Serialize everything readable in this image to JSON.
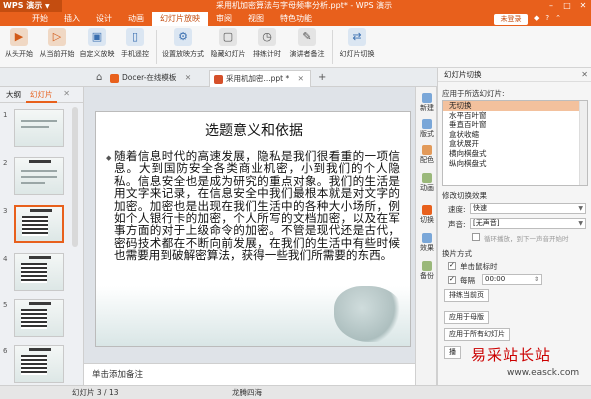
{
  "app": {
    "logo": "WPS 演示",
    "title": "采用机加密算法与字母频率分析.ppt* - WPS 演示",
    "win_min": "–",
    "win_max": "□",
    "win_close": "✕"
  },
  "menu": {
    "items": [
      "开始",
      "插入",
      "设计",
      "动画",
      "幻灯片放映",
      "审阅",
      "视图",
      "特色功能"
    ],
    "active": "幻灯片放映",
    "login": "未登录"
  },
  "ribbon": {
    "buttons": [
      {
        "label": "从头开始",
        "icon": "play-start-icon"
      },
      {
        "label": "从当前开始",
        "icon": "play-current-icon"
      },
      {
        "label": "自定义放映",
        "icon": "custom-show-icon"
      },
      {
        "label": "手机遥控",
        "icon": "phone-remote-icon"
      },
      {
        "label": "设置放映方式",
        "icon": "show-settings-icon"
      },
      {
        "label": "隐藏幻灯片",
        "icon": "hide-slide-icon"
      },
      {
        "label": "排练计时",
        "icon": "rehearse-timing-icon"
      },
      {
        "label": "演讲者备注",
        "icon": "speaker-notes-icon"
      },
      {
        "label": "幻灯片切换",
        "icon": "slide-transition-icon"
      }
    ]
  },
  "tabs": [
    {
      "label": "Docer-在线模板",
      "active": false
    },
    {
      "label": "采用机加密...ppt *",
      "active": true
    }
  ],
  "left_panel": {
    "tabs": [
      "大纲",
      "幻灯片"
    ],
    "active_tab": "幻灯片",
    "thumb_numbers": [
      "1",
      "2",
      "3",
      "4",
      "5",
      "6"
    ],
    "selected": "3"
  },
  "slide": {
    "title": "选题意义和依据",
    "body": "随着信息时代的高速发展，隐私是我们很看重的一项信息。大到国防安全各类商业机密，小到我们的个人隐私。信息安全也是成为研究的重点对象。我们的生活是用文字来记录，在信息安全中我们最根本就是对文字的加密。加密也是出现在我们生活中的各种大小场所，例如个人银行卡的加密，个人所写的文档加密，以及在军事方面的对于上级命令的加密。不管是现代还是古代，密码技术都在不断向前发展，在我们的生活中有些时候也需要用到破解密算法，获得一些我们所需要的东西。",
    "notes_placeholder": "单击添加备注"
  },
  "icon_bar": [
    "新建",
    "版式",
    "配色",
    "动画",
    "切换",
    "效果",
    "备份"
  ],
  "right_panel": {
    "header": "幻灯片切换",
    "apply_label": "应用于所选幻灯片:",
    "transitions": [
      "无切换",
      "水平百叶窗",
      "垂直百叶窗",
      "盒状收缩",
      "盒状展开",
      "横向棋盘式",
      "纵向棋盘式"
    ],
    "selected_transition": "无切换",
    "modify_label": "修改切换效果",
    "speed_label": "速度:",
    "speed_value": "快速",
    "sound_label": "声音:",
    "sound_value": "[无声音]",
    "loop_label": "循环播放，到下一声音开始时",
    "advance_label": "换片方式",
    "click_label": "单击鼠标时",
    "every_label": "每隔",
    "every_value": "00:00",
    "rehearse_btn": "排练当前页",
    "apply_master_btn": "应用于母版",
    "apply_all_btn": "应用于所有幻灯片",
    "play_btn": "播"
  },
  "status": {
    "slide_info": "幻灯片 3 / 13",
    "theme": "龙腾四海"
  },
  "watermark": {
    "text": "易采站长站",
    "url": "www.easck.com"
  },
  "colors": {
    "brand": "#e8601c",
    "selected_item": "#f3c19d"
  }
}
